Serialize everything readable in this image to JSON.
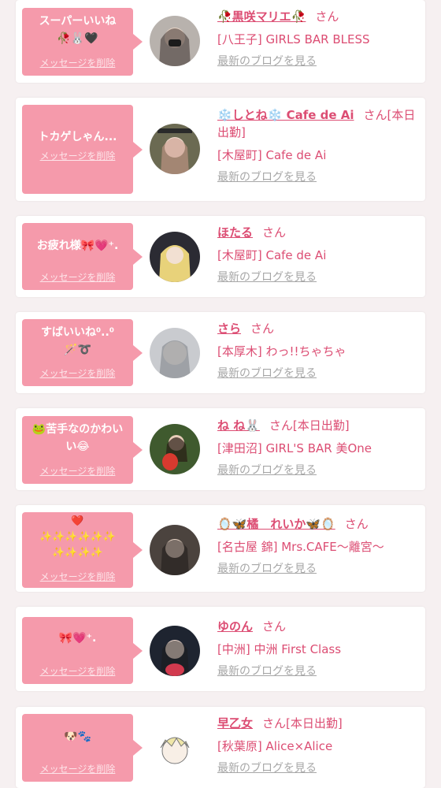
{
  "colors": {
    "accent": "#f59aab",
    "name_text": "#dc4d73",
    "link_gray": "#a7a7a7",
    "background": "#f6f0f1"
  },
  "delete_label": "メッセージを削除",
  "blog_label": "最新のブログを見る",
  "san_suffix": "さん",
  "cards": [
    {
      "message": "スーパーいいね\n🥀🐰🖤",
      "name": "🥀黒咲マリエ🥀",
      "status": "",
      "shop": "[八王子] GIRLS BAR BLESS"
    },
    {
      "message": "トカゲしゃん...",
      "name": "❄️しとね❄️ Cafe de Ai",
      "status": "[本日出勤]",
      "shop": "[木屋町] Cafe de Ai"
    },
    {
      "message": "お疲れ様🎀💗⁺.",
      "name": "ほたる",
      "status": "",
      "shop": "[木屋町] Cafe de Ai"
    },
    {
      "message": "すばいいね⁰..⁰\n🪄➰",
      "name": "さら",
      "status": "",
      "shop": "[本厚木] わっ!!ちゃちゃ"
    },
    {
      "message": "🐸苦手なのかわい\nい😂",
      "name": "ね ね🐰",
      "status": "[本日出勤]",
      "shop": "[津田沼] GIRL'S BAR 美One"
    },
    {
      "message": "❤️\n✨✨✨✨✨✨\n✨✨✨✨",
      "name": "🪞🦋橘　れいか🦋🪞",
      "status": "",
      "shop": "[名古屋 錦] Mrs.CAFE〜離宮〜"
    },
    {
      "message": "🎀💗⁺.",
      "name": "ゆのん",
      "status": "",
      "shop": "[中洲] 中洲 First Class"
    },
    {
      "message": "🐶🐾",
      "name": "早乙女",
      "status": "[本日出勤]",
      "shop": "[秋葉原] Alice×Alice"
    }
  ]
}
